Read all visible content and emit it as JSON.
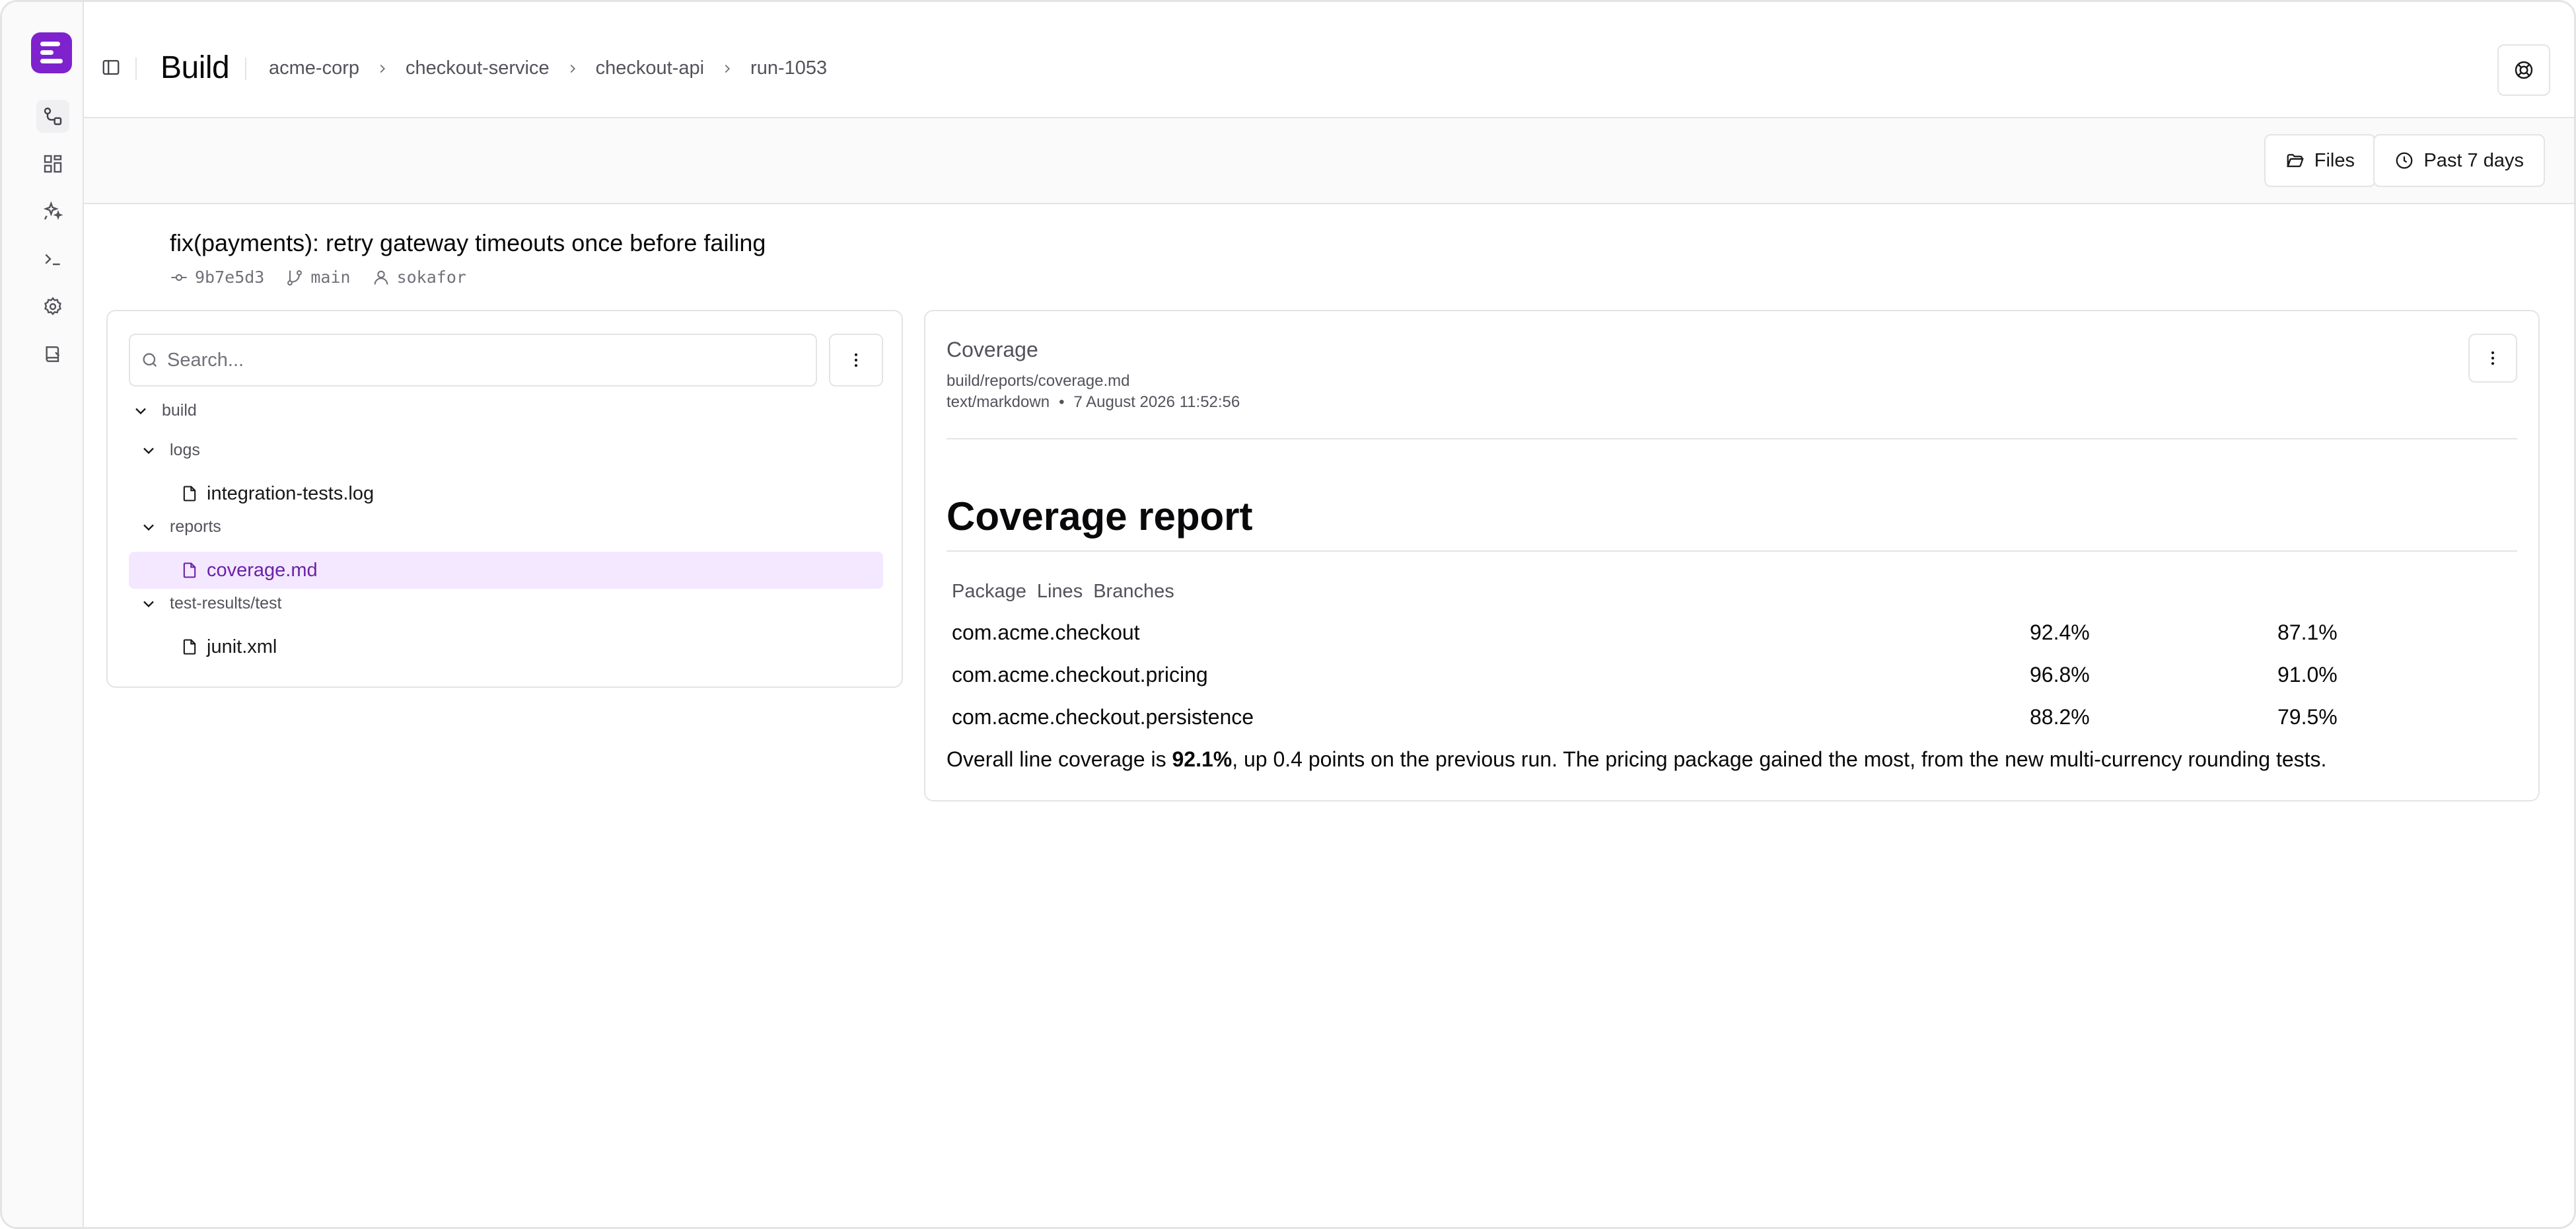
{
  "header": {
    "title": "Build",
    "breadcrumb": [
      "acme-corp",
      "checkout-service",
      "checkout-api",
      "run-1053"
    ]
  },
  "rail": {
    "items": [
      {
        "icon": "pipeline-icon",
        "active": true
      },
      {
        "icon": "dashboard-icon",
        "active": false
      },
      {
        "icon": "sparkles-icon",
        "active": false
      },
      {
        "icon": "terminal-icon",
        "active": false
      },
      {
        "icon": "gear-icon",
        "active": false
      },
      {
        "icon": "book-icon",
        "active": false
      }
    ]
  },
  "toolbar": {
    "files_label": "Files",
    "range_label": "Past 7 days"
  },
  "commit": {
    "message": "fix(payments): retry gateway timeouts once before failing",
    "sha": "9b7e5d3",
    "branch": "main",
    "author": "sokafor"
  },
  "tree": {
    "search_placeholder": "Search...",
    "nodes": [
      {
        "type": "folder",
        "label": "build",
        "depth": 0
      },
      {
        "type": "folder",
        "label": "logs",
        "depth": 1
      },
      {
        "type": "file",
        "label": "integration-tests.log",
        "depth": 2,
        "selected": false
      },
      {
        "type": "folder",
        "label": "reports",
        "depth": 1
      },
      {
        "type": "file",
        "label": "coverage.md",
        "depth": 2,
        "selected": true
      },
      {
        "type": "folder",
        "label": "test-results/test",
        "depth": 1
      },
      {
        "type": "file",
        "label": "junit.xml",
        "depth": 2,
        "selected": false
      }
    ]
  },
  "preview": {
    "title": "Coverage",
    "path": "build/reports/coverage.md",
    "mime": "text/markdown",
    "bullet": "•",
    "timestamp": "7 August 2026 11:52:56",
    "heading": "Coverage report",
    "table": {
      "headers": [
        "Package",
        "Lines",
        "Branches"
      ],
      "rows": [
        [
          "com.acme.checkout",
          "92.4%",
          "87.1%"
        ],
        [
          "com.acme.checkout.pricing",
          "96.8%",
          "91.0%"
        ],
        [
          "com.acme.checkout.persistence",
          "88.2%",
          "79.5%"
        ]
      ]
    },
    "summary_before": "Overall line coverage is ",
    "summary_bold": "92.1%",
    "summary_after": ", up 0.4 points on the previous run. The pricing package gained the most, from the new multi-currency rounding tests."
  },
  "colors": {
    "accent": "#7e22ce",
    "selected_bg": "#f3e8ff",
    "selected_text": "#6b21a8",
    "border": "#e4e4e7"
  }
}
